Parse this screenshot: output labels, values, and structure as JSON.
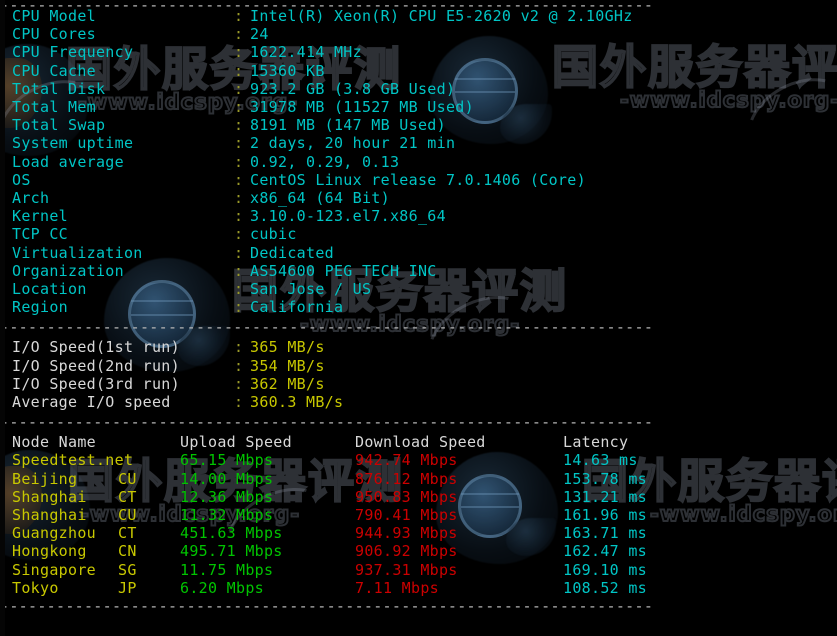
{
  "terminal": {
    "background": "#000000",
    "colors": {
      "cyan": "#00c5c5",
      "white": "#d8d8d8",
      "yellow": "#c8c800",
      "green": "#00c400",
      "red": "#cc0000",
      "separator": "#b8b8b8",
      "colon": "#9a9a28"
    },
    "separator_line": "----------------------------------------------------------------------"
  },
  "watermark": {
    "text_cn": "国外服务器评测",
    "text_url": "-www.idcspy.org-"
  },
  "system_info": {
    "colon": ":",
    "rows": [
      {
        "label": "CPU Model",
        "value": "Intel(R) Xeon(R) CPU E5-2620 v2 @ 2.10GHz"
      },
      {
        "label": "CPU Cores",
        "value": "24"
      },
      {
        "label": "CPU Frequency",
        "value": "1622.414 MHz"
      },
      {
        "label": "CPU Cache",
        "value": "15360 KB"
      },
      {
        "label": "Total Disk",
        "value": "923.2 GB (3.8 GB Used)"
      },
      {
        "label": "Total Mem",
        "value": "31978 MB (11527 MB Used)"
      },
      {
        "label": "Total Swap",
        "value": "8191 MB (147 MB Used)"
      },
      {
        "label": "System uptime",
        "value": "2 days, 20 hour 21 min"
      },
      {
        "label": "Load average",
        "value": "0.92, 0.29, 0.13"
      },
      {
        "label": "OS",
        "value": "CentOS Linux release 7.0.1406 (Core)"
      },
      {
        "label": "Arch",
        "value": "x86_64 (64 Bit)"
      },
      {
        "label": "Kernel",
        "value": "3.10.0-123.el7.x86_64"
      },
      {
        "label": "TCP CC",
        "value": "cubic"
      },
      {
        "label": "Virtualization",
        "value": "Dedicated"
      },
      {
        "label": "Organization",
        "value": "AS54600 PEG TECH INC"
      },
      {
        "label": "Location",
        "value": "San Jose / US"
      },
      {
        "label": "Region",
        "value": "California"
      }
    ]
  },
  "io_speed": {
    "colon": ":",
    "rows": [
      {
        "label": "I/O Speed(1st run)",
        "value": "365 MB/s"
      },
      {
        "label": "I/O Speed(2nd run)",
        "value": "354 MB/s"
      },
      {
        "label": "I/O Speed(3rd run)",
        "value": "362 MB/s"
      },
      {
        "label": "Average I/O speed",
        "value": "360.3 MB/s"
      }
    ]
  },
  "speedtest": {
    "headers": {
      "node": "Node Name",
      "upload": "Upload Speed",
      "download": "Download Speed",
      "latency": "Latency"
    },
    "rows": [
      {
        "node": "Speedtest.net",
        "isp": "",
        "upload": "65.15 Mbps",
        "download": "942.74 Mbps",
        "latency": "14.63 ms"
      },
      {
        "node": "Beijing",
        "isp": "CU",
        "upload": "14.00 Mbps",
        "download": "876.12 Mbps",
        "latency": "153.78 ms"
      },
      {
        "node": "Shanghai",
        "isp": "CT",
        "upload": "12.36 Mbps",
        "download": "950.83 Mbps",
        "latency": "131.21 ms"
      },
      {
        "node": "Shanghai",
        "isp": "CU",
        "upload": "11.32 Mbps",
        "download": "790.41 Mbps",
        "latency": "161.96 ms"
      },
      {
        "node": "Guangzhou",
        "isp": "CT",
        "upload": "451.63 Mbps",
        "download": "944.93 Mbps",
        "latency": "163.71 ms"
      },
      {
        "node": "Hongkong",
        "isp": "CN",
        "upload": "495.71 Mbps",
        "download": "906.92 Mbps",
        "latency": "162.47 ms"
      },
      {
        "node": "Singapore",
        "isp": "SG",
        "upload": "11.75 Mbps",
        "download": "937.31 Mbps",
        "latency": "169.10 ms"
      },
      {
        "node": "Tokyo",
        "isp": "JP",
        "upload": "6.20 Mbps",
        "download": "7.11 Mbps",
        "latency": "108.52 ms"
      }
    ]
  }
}
